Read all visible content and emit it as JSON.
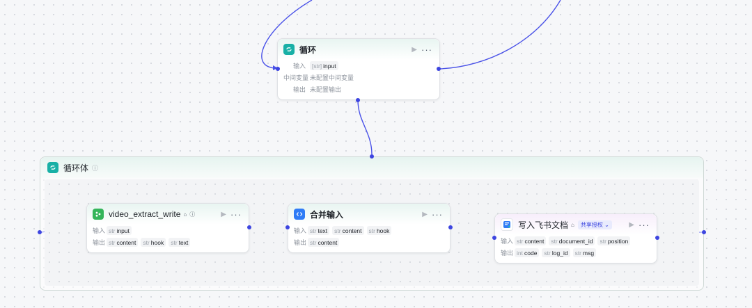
{
  "loop_node": {
    "title": "循环",
    "input_label": "输入",
    "input_type": "[str]",
    "input_name": "input",
    "vars_label": "中间变量",
    "vars_value": "未配置中间变量",
    "output_label": "输出",
    "output_value": "未配置输出"
  },
  "loop_body": {
    "title": "循环体",
    "info_icon": "info-icon"
  },
  "extract_node": {
    "title": "video_extract_write",
    "input_label": "输入",
    "inputs": [
      {
        "type": "str",
        "name": "input"
      }
    ],
    "output_label": "输出",
    "outputs": [
      {
        "type": "str",
        "name": "content"
      },
      {
        "type": "str",
        "name": "hook"
      },
      {
        "type": "str",
        "name": "text"
      }
    ]
  },
  "merge_node": {
    "title": "合并输入",
    "input_label": "输入",
    "inputs": [
      {
        "type": "str",
        "name": "text"
      },
      {
        "type": "str",
        "name": "content"
      },
      {
        "type": "str",
        "name": "hook"
      }
    ],
    "output_label": "输出",
    "outputs": [
      {
        "type": "str",
        "name": "content"
      }
    ]
  },
  "feishu_node": {
    "title": "写入飞书文档",
    "badge": "共享授权",
    "input_label": "输入",
    "inputs": [
      {
        "type": "str",
        "name": "content"
      },
      {
        "type": "str",
        "name": "document_id"
      },
      {
        "type": "str",
        "name": "position"
      }
    ],
    "output_label": "输出",
    "outputs": [
      {
        "type": "int",
        "name": "code"
      },
      {
        "type": "str",
        "name": "log_id"
      },
      {
        "type": "str",
        "name": "msg"
      }
    ]
  },
  "colors": {
    "edge": "#4a52e8",
    "port": "#3d45e0",
    "loop_icon": "#18b0a6",
    "plugin_icon": "#34b55a",
    "code_icon": "#2f7cf6"
  }
}
